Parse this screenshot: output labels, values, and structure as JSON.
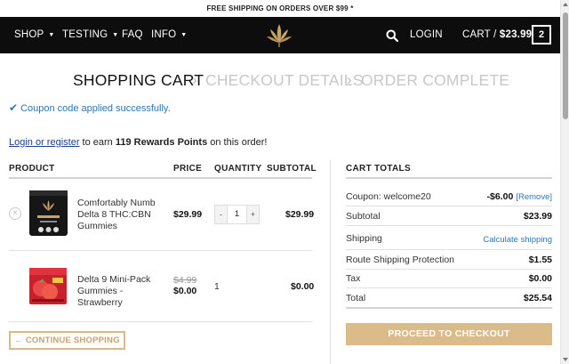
{
  "announcement": "FREE SHIPPING ON ORDERS OVER $99 *",
  "nav": {
    "items": [
      {
        "label": "SHOP",
        "has_caret": true
      },
      {
        "label": "TESTING",
        "has_caret": true
      },
      {
        "label": "FAQ",
        "has_caret": false
      },
      {
        "label": "INFO",
        "has_caret": true
      }
    ],
    "login_label": "LOGIN",
    "cart_label": "CART /",
    "cart_total": "$23.99",
    "cart_count": "2",
    "logo_icon": "leaf-logo-icon",
    "search_icon": "search-icon"
  },
  "steps": [
    {
      "label": "SHOPPING CART",
      "state": "active"
    },
    {
      "label": "CHECKOUT DETAILS",
      "state": "inactive"
    },
    {
      "label": "ORDER COMPLETE",
      "state": "inactive"
    }
  ],
  "step_separator": "›",
  "notice": {
    "check_icon": "check-icon",
    "text": "Coupon code applied successfully."
  },
  "rewards": {
    "link": "Login or register",
    "text_before": " to earn ",
    "points": "119 Rewards Points",
    "text_after": " on this order!"
  },
  "table": {
    "headers": {
      "product": "PRODUCT",
      "price": "PRICE",
      "quantity": "QUANTITY",
      "subtotal": "SUBTOTAL"
    },
    "rows": [
      {
        "name": "Comfortably Numb Delta 8 THC:CBN Gummies",
        "price": "$29.99",
        "quantity": "1",
        "subtotal": "$29.99",
        "qty_minus": "-",
        "qty_plus": "+",
        "remove": "×"
      },
      {
        "name": "Delta 9 Mini-Pack Gummies - Strawberry",
        "old_price": "$4.99",
        "price": "$0.00",
        "quantity": "1",
        "subtotal": "$0.00"
      }
    ]
  },
  "continue_button": "← CONTINUE SHOPPING",
  "totals": {
    "title": "CART TOTALS",
    "coupon_label": "Coupon: welcome20",
    "coupon_value": "-$6.00",
    "coupon_remove": "[Remove]",
    "subtotal_label": "Subtotal",
    "subtotal_value": "$23.99",
    "shipping_label": "Shipping",
    "shipping_value": "Calculate shipping",
    "route_label": "Route Shipping Protection",
    "route_value": "$1.55",
    "tax_label": "Tax",
    "tax_value": "$0.00",
    "total_label": "Total",
    "total_value": "$25.54"
  },
  "checkout_button": "PROCEED TO CHECKOUT",
  "colors": {
    "accent": "#dcbb8a",
    "link": "#2a76b5",
    "nav_bg": "#0d0d0d"
  }
}
